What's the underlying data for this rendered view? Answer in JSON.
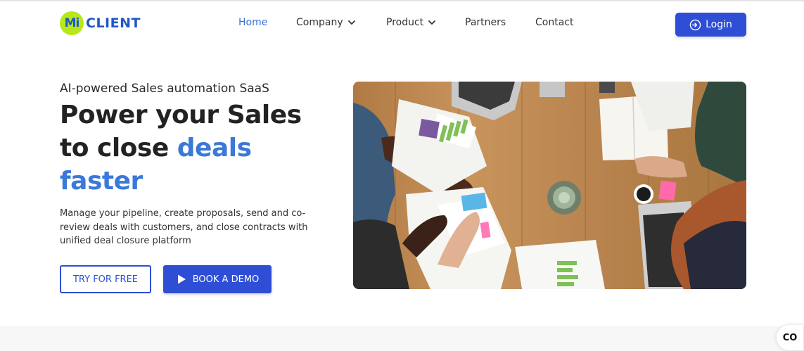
{
  "header": {
    "logo_badge": "Mi",
    "logo_text": "CLIENT",
    "nav": [
      {
        "label": "Home",
        "active": true,
        "dropdown": false
      },
      {
        "label": "Company",
        "active": false,
        "dropdown": true
      },
      {
        "label": "Product",
        "active": false,
        "dropdown": true
      },
      {
        "label": "Partners",
        "active": false,
        "dropdown": false
      },
      {
        "label": "Contact",
        "active": false,
        "dropdown": false
      }
    ],
    "login_label": "Login",
    "login_icon": "login-icon"
  },
  "hero": {
    "eyebrow": "AI-powered Sales automation SaaS",
    "headline_line1": "Power your Sales",
    "headline_line2_prefix": "to close ",
    "headline_accent_1": "deals",
    "headline_accent_2": "faster",
    "description": "Manage your pipeline, create proposals, send and co-review deals with customers, and close contracts with unified deal closure platform",
    "try_label": "TRY FOR FREE",
    "demo_label": "BOOK A DEMO",
    "demo_icon": "play-icon",
    "image_icon": "team-meeting-photo"
  },
  "widget": {
    "label": "CO"
  },
  "colors": {
    "brand_blue": "#2e4ed6",
    "accent_blue": "#3b78d8",
    "logo_green": "#b7e81a"
  }
}
